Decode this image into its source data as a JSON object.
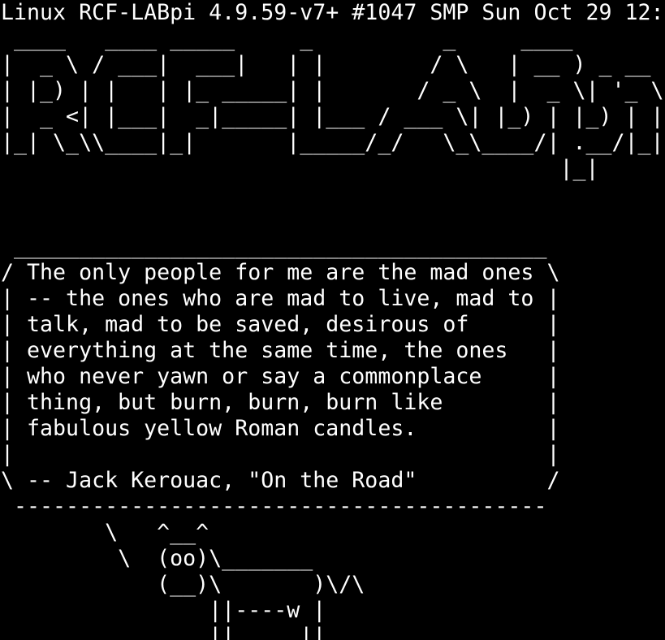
{
  "terminal": {
    "foreground": "#ffffff",
    "background": "#000000",
    "header_line": "Linux RCF-LABpi 4.9.59-v7+ #1047 SMP Sun Oct 29 12:",
    "banner_lines": [
      " ____   ____ _____     _          _     ____        _",
      "|  _ \\ / ___|  ___|   | |        / \\   | __ ) _ __ (_)",
      "| |_) | |   | |_ _____| |       / _ \\  |  _ \\| '_ \\| |",
      "|  _ <| |___|  _|_____| |___ / ___ \\| |_) | |_) | |",
      "|_| \\_\\\\____|_|       |_____/_/   \\_\\____/| .__/|_|",
      "                                           |_|"
    ],
    "blank_lines": [
      "",
      ""
    ],
    "cowsay": {
      "top_border": " _________________________________________",
      "message_lines": [
        "/ The only people for me are the mad ones \\",
        "| -- the ones who are mad to live, mad to |",
        "| talk, mad to be saved, desirous of      |",
        "| everything at the same time, the ones   |",
        "| who never yawn or say a commonplace     |",
        "| thing, but burn, burn, burn like        |",
        "| fabulous yellow Roman candles.          |",
        "|                                         |",
        "\\ -- Jack Kerouac, \"On the Road\"          /"
      ],
      "bottom_border": " -----------------------------------------",
      "cow_lines": [
        "        \\   ^__^",
        "         \\  (oo)\\_______",
        "            (__)\\       )\\/\\",
        "                ||----w |",
        "                ||     ||"
      ]
    }
  }
}
